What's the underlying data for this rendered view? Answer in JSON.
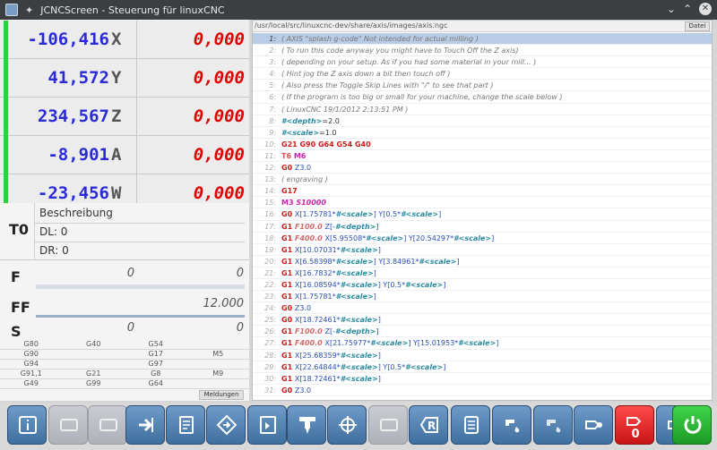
{
  "window": {
    "title": "JCNCScreen - Steuerung für linuxCNC"
  },
  "axes": [
    {
      "pos": "-106,416",
      "letter": "X",
      "dtg": "0,000"
    },
    {
      "pos": "41,572",
      "letter": "Y",
      "dtg": "0,000"
    },
    {
      "pos": "234,567",
      "letter": "Z",
      "dtg": "0,000"
    },
    {
      "pos": "-8,901",
      "letter": "A",
      "dtg": "0,000"
    },
    {
      "pos": "-23,456",
      "letter": "W",
      "dtg": "0,000"
    }
  ],
  "tool": {
    "number": "T0",
    "description": "Beschreibung",
    "dl": "DL: 0",
    "dr": "DR: 0"
  },
  "feed": {
    "label": "F",
    "value": "0",
    "value2": "0",
    "progress": 0
  },
  "feed_factor": {
    "label": "FF",
    "value": "12.000",
    "progress": 1.0
  },
  "spindle": {
    "label": "S",
    "value": "0",
    "value2": "0",
    "progress": 0
  },
  "gcodes": [
    [
      "G80",
      "G40",
      "G54",
      ""
    ],
    [
      "G90",
      "",
      "G17",
      "M5"
    ],
    [
      "G94",
      "",
      "G97",
      ""
    ],
    [
      "G91,1",
      "G21",
      "G8",
      "M9"
    ],
    [
      "G49",
      "G99",
      "G64",
      ""
    ]
  ],
  "messages_button": "Meldungen",
  "program": {
    "path": "/usr/local/src/linuxcnc-dev/share/axis/images/axis.ngc",
    "file_button": "Datei",
    "active_line": 1,
    "lines": [
      {
        "n": "1:",
        "tokens": [
          [
            "cmt",
            "( AXIS \"splash g-code\" Not intended for actual milling )"
          ]
        ]
      },
      {
        "n": "2:",
        "tokens": [
          [
            "cmt",
            "( To run this code anyway you might have to Touch Off the Z axis)"
          ]
        ]
      },
      {
        "n": "3:",
        "tokens": [
          [
            "cmt",
            "( depending on your setup. As if you had some material in your mill... )"
          ]
        ]
      },
      {
        "n": "4:",
        "tokens": [
          [
            "cmt",
            "( Hint jog the Z axis down a bit then touch off )"
          ]
        ]
      },
      {
        "n": "5:",
        "tokens": [
          [
            "cmt",
            "( Also press the Toggle Skip Lines with \"/\" to see that part )"
          ]
        ]
      },
      {
        "n": "6:",
        "tokens": [
          [
            "cmt",
            "( If the program is too big or small for your machine, change the scale below )"
          ]
        ]
      },
      {
        "n": "7:",
        "tokens": [
          [
            "cmt",
            "( LinuxCNC 19/1/2012 2:13:51 PM )"
          ]
        ]
      },
      {
        "n": "8:",
        "tokens": [
          [
            "var",
            "#<depth>"
          ],
          [
            "plain",
            "=2.0"
          ]
        ]
      },
      {
        "n": "9:",
        "tokens": [
          [
            "var",
            "#<scale>"
          ],
          [
            "plain",
            "=1.0"
          ]
        ]
      },
      {
        "n": "10:",
        "tokens": [
          [
            "g",
            "G21 G90 G64 G54 G40"
          ]
        ]
      },
      {
        "n": "11:",
        "tokens": [
          [
            "t",
            "T6 "
          ],
          [
            "m",
            "M6"
          ]
        ]
      },
      {
        "n": "12:",
        "tokens": [
          [
            "g",
            "G0 "
          ],
          [
            "ax",
            "Z3.0"
          ]
        ]
      },
      {
        "n": "13:",
        "tokens": [
          [
            "cmt",
            "( engraving )"
          ]
        ]
      },
      {
        "n": "14:",
        "tokens": [
          [
            "g",
            "G17"
          ]
        ]
      },
      {
        "n": "15:",
        "tokens": [
          [
            "m",
            "M3 "
          ],
          [
            "s",
            "S10000"
          ]
        ]
      },
      {
        "n": "16:",
        "tokens": [
          [
            "g",
            "G0 "
          ],
          [
            "ax",
            "X[1.75781*"
          ],
          [
            "var",
            "#<scale>"
          ],
          [
            "ax",
            "] Y[0.5*"
          ],
          [
            "var",
            "#<scale>"
          ],
          [
            "ax",
            "]"
          ]
        ]
      },
      {
        "n": "17:",
        "tokens": [
          [
            "g",
            "G1 "
          ],
          [
            "f",
            "F100.0 "
          ],
          [
            "ax",
            "Z[-"
          ],
          [
            "var",
            "#<depth>"
          ],
          [
            "ax",
            "]"
          ]
        ]
      },
      {
        "n": "18:",
        "tokens": [
          [
            "g",
            "G1 "
          ],
          [
            "f",
            "F400.0 "
          ],
          [
            "ax",
            "X[5.95508*"
          ],
          [
            "var",
            "#<scale>"
          ],
          [
            "ax",
            "] Y[20.54297*"
          ],
          [
            "var",
            "#<scale>"
          ],
          [
            "ax",
            "]"
          ]
        ]
      },
      {
        "n": "19:",
        "tokens": [
          [
            "g",
            "G1 "
          ],
          [
            "ax",
            "X[10.07031*"
          ],
          [
            "var",
            "#<scale>"
          ],
          [
            "ax",
            "]"
          ]
        ]
      },
      {
        "n": "20:",
        "tokens": [
          [
            "g",
            "G1 "
          ],
          [
            "ax",
            "X[6.58398*"
          ],
          [
            "var",
            "#<scale>"
          ],
          [
            "ax",
            "] Y[3.84961*"
          ],
          [
            "var",
            "#<scale>"
          ],
          [
            "ax",
            "]"
          ]
        ]
      },
      {
        "n": "21:",
        "tokens": [
          [
            "g",
            "G1 "
          ],
          [
            "ax",
            "X[16.7832*"
          ],
          [
            "var",
            "#<scale>"
          ],
          [
            "ax",
            "]"
          ]
        ]
      },
      {
        "n": "22:",
        "tokens": [
          [
            "g",
            "G1 "
          ],
          [
            "ax",
            "X[16.08594*"
          ],
          [
            "var",
            "#<scale>"
          ],
          [
            "ax",
            "] Y[0.5*"
          ],
          [
            "var",
            "#<scale>"
          ],
          [
            "ax",
            "]"
          ]
        ]
      },
      {
        "n": "23:",
        "tokens": [
          [
            "g",
            "G1 "
          ],
          [
            "ax",
            "X[1.75781*"
          ],
          [
            "var",
            "#<scale>"
          ],
          [
            "ax",
            "]"
          ]
        ]
      },
      {
        "n": "24:",
        "tokens": [
          [
            "g",
            "G0 "
          ],
          [
            "ax",
            "Z3.0"
          ]
        ]
      },
      {
        "n": "25:",
        "tokens": [
          [
            "g",
            "G0 "
          ],
          [
            "ax",
            "X[18.72461*"
          ],
          [
            "var",
            "#<scale>"
          ],
          [
            "ax",
            "]"
          ]
        ]
      },
      {
        "n": "26:",
        "tokens": [
          [
            "g",
            "G1 "
          ],
          [
            "f",
            "F100.0 "
          ],
          [
            "ax",
            "Z[-"
          ],
          [
            "var",
            "#<depth>"
          ],
          [
            "ax",
            "]"
          ]
        ]
      },
      {
        "n": "27:",
        "tokens": [
          [
            "g",
            "G1 "
          ],
          [
            "f",
            "F400.0 "
          ],
          [
            "ax",
            "X[21.75977*"
          ],
          [
            "var",
            "#<scale>"
          ],
          [
            "ax",
            "] Y[15.01953*"
          ],
          [
            "var",
            "#<scale>"
          ],
          [
            "ax",
            "]"
          ]
        ]
      },
      {
        "n": "28:",
        "tokens": [
          [
            "g",
            "G1 "
          ],
          [
            "ax",
            "X[25.68359*"
          ],
          [
            "var",
            "#<scale>"
          ],
          [
            "ax",
            "]"
          ]
        ]
      },
      {
        "n": "29:",
        "tokens": [
          [
            "g",
            "G1 "
          ],
          [
            "ax",
            "X[22.64844*"
          ],
          [
            "var",
            "#<scale>"
          ],
          [
            "ax",
            "] Y[0.5*"
          ],
          [
            "var",
            "#<scale>"
          ],
          [
            "ax",
            "]"
          ]
        ]
      },
      {
        "n": "30:",
        "tokens": [
          [
            "g",
            "G1 "
          ],
          [
            "ax",
            "X[18.72461*"
          ],
          [
            "var",
            "#<scale>"
          ],
          [
            "ax",
            "]"
          ]
        ]
      },
      {
        "n": "31:",
        "tokens": [
          [
            "g",
            "G0 "
          ],
          [
            "ax",
            "Z3.0"
          ]
        ]
      }
    ]
  },
  "toolbar": [
    {
      "name": "info-button",
      "icon": "info-icon",
      "state": "enabled",
      "label": "i"
    },
    {
      "name": "tb-disabled-1",
      "icon": "disabled-icon",
      "state": "disabled",
      "label": ""
    },
    {
      "name": "tb-disabled-2",
      "icon": "disabled-icon",
      "state": "disabled",
      "label": ""
    },
    {
      "name": "enter-button",
      "icon": "enter-arrow-icon",
      "state": "enabled",
      "label": ""
    },
    {
      "name": "file-button",
      "icon": "file-icon",
      "state": "enabled",
      "label": ""
    },
    {
      "name": "direction-button",
      "icon": "direction-icon",
      "state": "enabled",
      "label": ""
    },
    {
      "name": "tool-button",
      "icon": "tool-icon",
      "state": "enabled",
      "label": ""
    },
    {
      "name": "spindle-button",
      "icon": "spindle-icon",
      "state": "enabled",
      "label": ""
    },
    {
      "name": "crosshair-button",
      "icon": "crosshair-icon",
      "state": "enabled",
      "label": ""
    },
    {
      "name": "tb-disabled-3",
      "icon": "disabled-icon",
      "state": "disabled",
      "label": ""
    },
    {
      "name": "r-button",
      "icon": "r-icon",
      "state": "enabled",
      "label": "R"
    },
    {
      "name": "list-button",
      "icon": "list-icon",
      "state": "enabled",
      "label": ""
    },
    {
      "name": "coolant-button",
      "icon": "coolant-icon",
      "state": "enabled",
      "label": ""
    },
    {
      "name": "coolant-off-button",
      "icon": "coolant-off-icon",
      "state": "disabled-blue",
      "label": ""
    },
    {
      "name": "machine-button",
      "icon": "machine-icon",
      "state": "enabled",
      "label": ""
    },
    {
      "name": "estop-button",
      "icon": "estop-icon",
      "state": "red",
      "label": "0"
    },
    {
      "name": "machine-on-button",
      "icon": "machine-icon",
      "state": "enabled",
      "label": ""
    },
    {
      "name": "power-button",
      "icon": "power-icon",
      "state": "green",
      "label": ""
    }
  ],
  "colors": {
    "axis_pos": "#2a2ad6",
    "axis_dtg": "#e00000",
    "homed_bar": "#2fd13a",
    "active_line": "#b9cce6"
  }
}
